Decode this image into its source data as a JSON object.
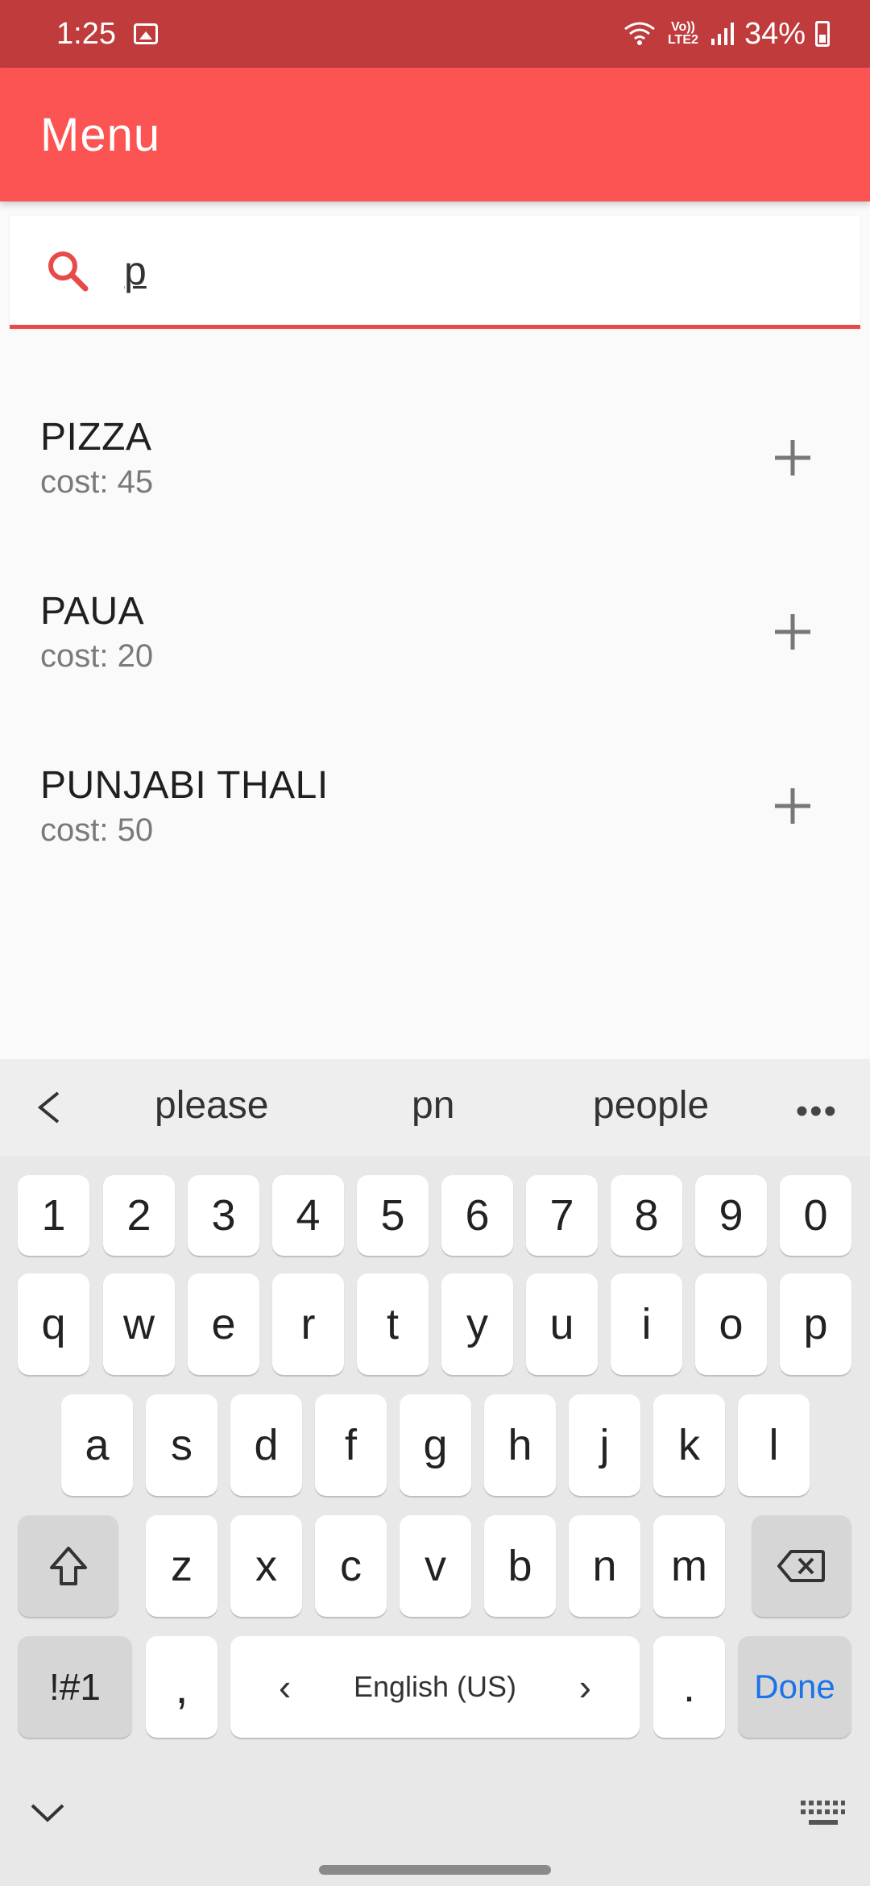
{
  "status_bar": {
    "time": "1:25",
    "network_label": "Vo)) LTE2",
    "battery": "34%"
  },
  "app_bar": {
    "title": "Menu"
  },
  "search": {
    "value": "p",
    "placeholder": ""
  },
  "menu_items": [
    {
      "name": "PIZZA",
      "cost": "cost: 45"
    },
    {
      "name": "PAUA",
      "cost": "cost: 20"
    },
    {
      "name": "PUNJABI THALI",
      "cost": "cost: 50"
    }
  ],
  "keyboard": {
    "suggestions": [
      "please",
      "pn",
      "people"
    ],
    "more": "•••",
    "row_numbers": [
      "1",
      "2",
      "3",
      "4",
      "5",
      "6",
      "7",
      "8",
      "9",
      "0"
    ],
    "row_q": [
      "q",
      "w",
      "e",
      "r",
      "t",
      "y",
      "u",
      "i",
      "o",
      "p"
    ],
    "row_a": [
      "a",
      "s",
      "d",
      "f",
      "g",
      "h",
      "j",
      "k",
      "l"
    ],
    "row_z": [
      "z",
      "x",
      "c",
      "v",
      "b",
      "n",
      "m"
    ],
    "symbols": "!#1",
    "comma": ",",
    "space_label": "English (US)",
    "space_left": "‹",
    "space_right": "›",
    "period": ".",
    "done": "Done"
  },
  "colors": {
    "status_bar": "#c03b3c",
    "app_bar": "#fc5353",
    "accent": "#e84a49",
    "done_text": "#1a73e8"
  }
}
